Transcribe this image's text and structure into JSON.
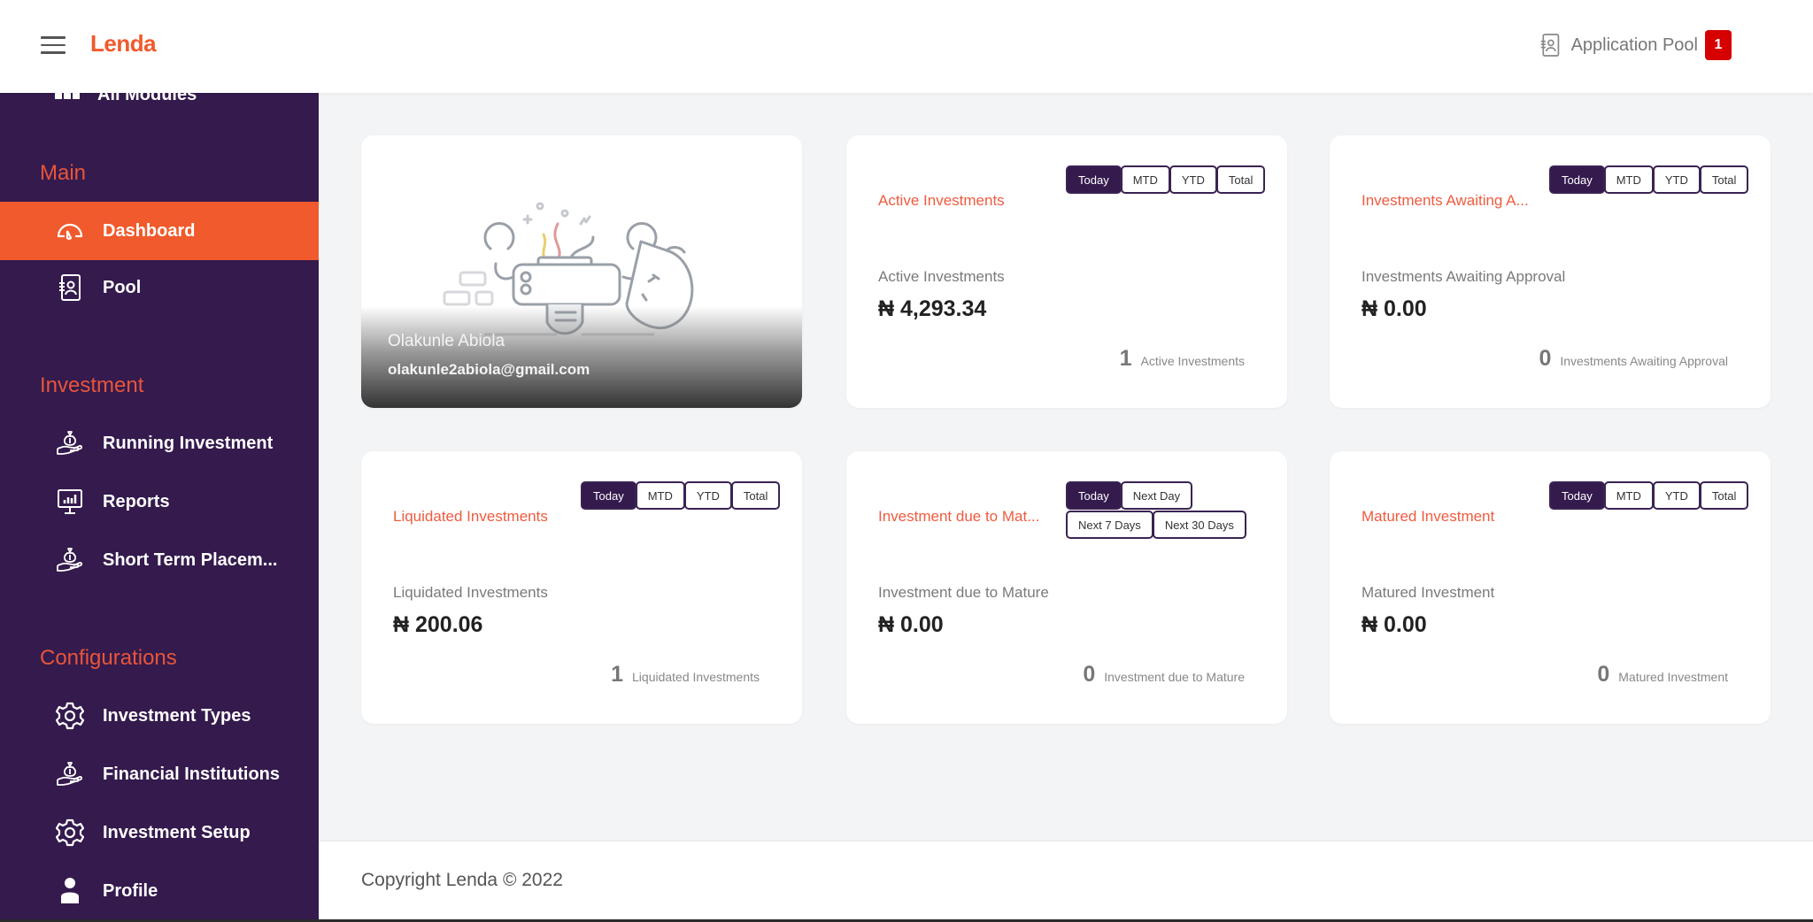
{
  "header": {
    "brand": "Lenda",
    "application_pool_label": "Application Pool",
    "application_pool_count": "1"
  },
  "sidebar": {
    "partially_hidden_item": "All Modules",
    "sections": [
      {
        "title": "Main",
        "items": [
          {
            "label": "Dashboard",
            "icon": "gauge-icon",
            "active": true
          },
          {
            "label": "Pool",
            "icon": "contact-book-icon",
            "active": false
          }
        ]
      },
      {
        "title": "Investment",
        "items": [
          {
            "label": "Running Investment",
            "icon": "money-bag-hand-icon"
          },
          {
            "label": "Reports",
            "icon": "monitor-chart-icon"
          },
          {
            "label": "Short Term Placem...",
            "icon": "money-bag-hand-icon"
          }
        ]
      },
      {
        "title": "Configurations",
        "items": [
          {
            "label": "Investment Types",
            "icon": "gear-icon"
          },
          {
            "label": "Financial Institutions",
            "icon": "money-bag-hand-icon"
          },
          {
            "label": "Investment Setup",
            "icon": "gear-icon"
          },
          {
            "label": "Profile",
            "icon": "user-icon"
          }
        ]
      }
    ]
  },
  "profile": {
    "name": "Olakunle Abiola",
    "email": "olakunle2abiola@gmail.com"
  },
  "cards": [
    {
      "title": "Active Investments",
      "periods": [
        "Today",
        "MTD",
        "YTD",
        "Total"
      ],
      "active_period": "Today",
      "sub_label": "Active Investments",
      "amount": "₦ 4,293.34",
      "count": "1",
      "count_label": "Active Investments"
    },
    {
      "title": "Investments Awaiting A...",
      "periods": [
        "Today",
        "MTD",
        "YTD",
        "Total"
      ],
      "active_period": "Today",
      "sub_label": "Investments Awaiting Approval",
      "amount": "₦ 0.00",
      "count": "0",
      "count_label": "Investments Awaiting Approval"
    },
    {
      "title": "Liquidated Investments",
      "periods": [
        "Today",
        "MTD",
        "YTD",
        "Total"
      ],
      "active_period": "Today",
      "sub_label": "Liquidated Investments",
      "amount": "₦ 200.06",
      "count": "1",
      "count_label": "Liquidated Investments"
    },
    {
      "title": "Investment due to Mat...",
      "periods": [
        "Today",
        "Next Day",
        "Next 7 Days",
        "Next 30 Days"
      ],
      "active_period": "Today",
      "sub_label": "Investment due to Mature",
      "amount": "₦ 0.00",
      "count": "0",
      "count_label": "Investment due to Mature"
    },
    {
      "title": "Matured Investment",
      "periods": [
        "Today",
        "MTD",
        "YTD",
        "Total"
      ],
      "active_period": "Today",
      "sub_label": "Matured Investment",
      "amount": "₦ 0.00",
      "count": "0",
      "count_label": "Matured Investment"
    }
  ],
  "footer": {
    "copyright": "Copyright Lenda © 2022"
  },
  "colors": {
    "brand_orange": "#f05a2c",
    "sidebar_purple": "#341a4d",
    "badge_red": "#d60000",
    "title_red": "#ef5b3f"
  }
}
